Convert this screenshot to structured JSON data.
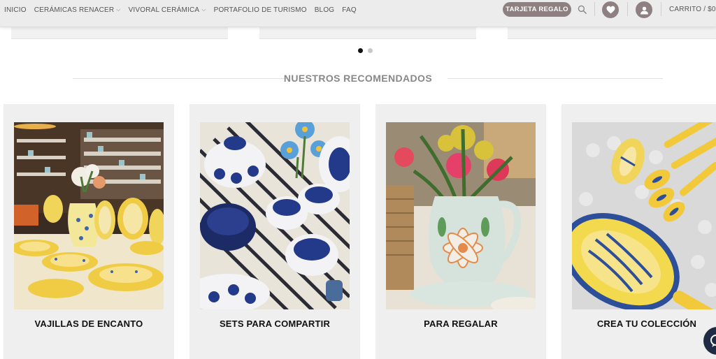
{
  "nav": {
    "items": [
      {
        "label": "INICIO",
        "has_dropdown": false
      },
      {
        "label": "CERÁMICAS RENACER",
        "has_dropdown": true
      },
      {
        "label": "VIVORAL CERÁMICA",
        "has_dropdown": true
      },
      {
        "label": "PORTAFOLIO DE TURISMO",
        "has_dropdown": false
      },
      {
        "label": "BLOG",
        "has_dropdown": false
      },
      {
        "label": "FAQ",
        "has_dropdown": false
      }
    ],
    "dropdown_glyph": "⌵"
  },
  "header": {
    "gift_button_label": "TARJETA REGALO",
    "cart_label": "CARRITO / $0",
    "icons": [
      "search-icon",
      "heart-icon",
      "user-icon"
    ]
  },
  "slider": {
    "dot_count": 2,
    "active_index": 0
  },
  "section": {
    "title": "NUESTROS RECOMENDADOS"
  },
  "cards": [
    {
      "title": "VAJILLAS DE ENCANTO"
    },
    {
      "title": "SETS PARA COMPARTIR"
    },
    {
      "title": "PARA REGALAR"
    },
    {
      "title": "CREA TU COLECCIÓN"
    }
  ],
  "colors": {
    "header_bg": "#ececec",
    "accent": "#8e8080",
    "card_bg": "#efefef",
    "chat_bg": "#1f2a44"
  }
}
